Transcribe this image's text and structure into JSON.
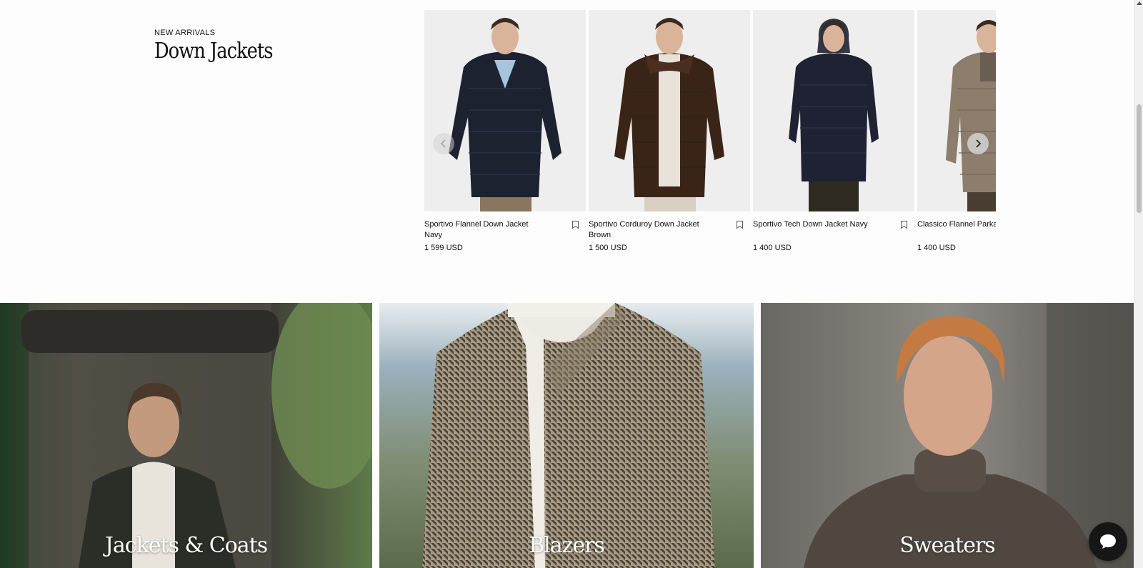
{
  "section": {
    "eyebrow": "NEW ARRIVALS",
    "title": "Down Jackets"
  },
  "products": [
    {
      "name": "Sportivo Flannel Down Jacket Navy",
      "price": "1 599 USD",
      "jacket_color": "#1c2230",
      "shirt_color": "#a8c4dc",
      "pants_color": "#8a7560"
    },
    {
      "name": "Sportivo Corduroy Down Jacket Brown",
      "price": "1 500 USD",
      "jacket_color": "#3a2418",
      "shirt_color": "#e8e2d8",
      "pants_color": "#d8d0c2"
    },
    {
      "name": "Sportivo Tech Down Jacket Navy",
      "price": "1 400 USD",
      "jacket_color": "#1f2233",
      "shirt_color": "#1f2233",
      "pants_color": "#2e2a22"
    },
    {
      "name": "Classico Flannel Parka",
      "price": "1 400 USD",
      "jacket_color": "#8c7d6c",
      "shirt_color": "#6a5e50",
      "pants_color": "#4a3e32"
    }
  ],
  "categories": [
    {
      "label": "Jackets & Coats"
    },
    {
      "label": "Blazers"
    },
    {
      "label": "Sweaters"
    }
  ],
  "icons": {
    "prev": "chevron-left-icon",
    "next": "chevron-right-icon",
    "bookmark": "bookmark-icon",
    "chat": "chat-bubble-icon"
  }
}
